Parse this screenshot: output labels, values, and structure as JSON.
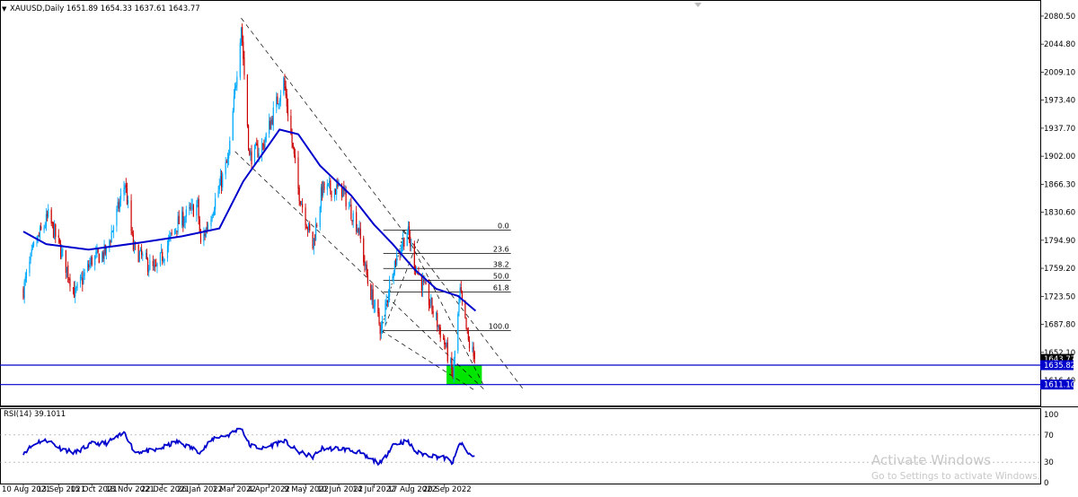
{
  "header": {
    "arrow_glyph": "▼",
    "symbol_info": "XAUUSD,Daily  1651.89 1654.33 1637.61 1643.77"
  },
  "rsi_header": "RSI(14) 39.1011",
  "price_axis": [
    "2080.50",
    "2044.80",
    "2009.10",
    "1973.40",
    "1937.70",
    "1902.00",
    "1866.30",
    "1830.60",
    "1794.90",
    "1759.20",
    "1723.50",
    "1687.80",
    "1652.10",
    "1616.40"
  ],
  "price_badges": {
    "current": "1643.77",
    "support_top": "1635.82",
    "support_bottom": "1611.10"
  },
  "rsi_axis": [
    "100",
    "70",
    "30",
    "0"
  ],
  "date_axis": [
    "10 Aug 2021",
    "13 Sep 2021",
    "15 Oct 2021",
    "18 Nov 2021",
    "22 Dec 2021",
    "26 Jan 2022",
    "1 Mar 2022",
    "4 Apr 2022",
    "9 May 2022",
    "10 Jun 2022",
    "14 Jul 2022",
    "17 Aug 2022",
    "20 Sep 2022"
  ],
  "fib_levels": [
    "0.0",
    "23.6",
    "38.2",
    "50.0",
    "61.8",
    "100.0"
  ],
  "watermark": {
    "title": "Activate Windows",
    "subtitle": "Go to Settings to activate Windows."
  },
  "colors": {
    "bull": "#00aaff",
    "bear": "#cc0000",
    "ma": "#0000cc",
    "rsi": "#0000cc",
    "support_zone": "#00e600",
    "badge_bg": "#0000cc",
    "price_badge_bg": "#000000"
  },
  "chart_data": [
    {
      "type": "candlestick",
      "symbol": "XAUUSD",
      "timeframe": "Daily",
      "last_bar": {
        "open": 1651.89,
        "high": 1654.33,
        "low": 1637.61,
        "close": 1643.77
      },
      "ylim": [
        1605,
        2085
      ],
      "x_ticks": [
        "10 Aug 2021",
        "13 Sep 2021",
        "15 Oct 2021",
        "18 Nov 2021",
        "22 Dec 2021",
        "26 Jan 2022",
        "1 Mar 2022",
        "4 Apr 2022",
        "9 May 2022",
        "10 Jun 2022",
        "14 Jul 2022",
        "17 Aug 2022",
        "20 Sep 2022"
      ],
      "path_points": [
        {
          "date": "2021-08-10",
          "price": 1732
        },
        {
          "date": "2021-08-20",
          "price": 1785
        },
        {
          "date": "2021-09-03",
          "price": 1825
        },
        {
          "date": "2021-09-13",
          "price": 1790
        },
        {
          "date": "2021-09-29",
          "price": 1726
        },
        {
          "date": "2021-10-15",
          "price": 1770
        },
        {
          "date": "2021-10-29",
          "price": 1780
        },
        {
          "date": "2021-11-16",
          "price": 1868
        },
        {
          "date": "2021-11-24",
          "price": 1785
        },
        {
          "date": "2021-12-15",
          "price": 1755
        },
        {
          "date": "2022-01-05",
          "price": 1815
        },
        {
          "date": "2022-01-25",
          "price": 1840
        },
        {
          "date": "2022-01-28",
          "price": 1788
        },
        {
          "date": "2022-02-24",
          "price": 1900
        },
        {
          "date": "2022-03-08",
          "price": 2070
        },
        {
          "date": "2022-03-16",
          "price": 1900
        },
        {
          "date": "2022-03-29",
          "price": 1915
        },
        {
          "date": "2022-04-18",
          "price": 1998
        },
        {
          "date": "2022-05-02",
          "price": 1860
        },
        {
          "date": "2022-05-16",
          "price": 1787
        },
        {
          "date": "2022-05-25",
          "price": 1860
        },
        {
          "date": "2022-06-13",
          "price": 1860
        },
        {
          "date": "2022-06-29",
          "price": 1810
        },
        {
          "date": "2022-07-08",
          "price": 1742
        },
        {
          "date": "2022-07-21",
          "price": 1680
        },
        {
          "date": "2022-08-01",
          "price": 1760
        },
        {
          "date": "2022-08-15",
          "price": 1808
        },
        {
          "date": "2022-08-24",
          "price": 1757
        },
        {
          "date": "2022-09-07",
          "price": 1712
        },
        {
          "date": "2022-09-21",
          "price": 1660
        },
        {
          "date": "2022-09-28",
          "price": 1622
        },
        {
          "date": "2022-10-05",
          "price": 1728
        },
        {
          "date": "2022-10-13",
          "price": 1665
        },
        {
          "date": "2022-10-19",
          "price": 1643.77
        }
      ],
      "moving_average": [
        {
          "date": "2021-08-10",
          "price": 1806
        },
        {
          "date": "2021-09-01",
          "price": 1790
        },
        {
          "date": "2021-10-12",
          "price": 1783
        },
        {
          "date": "2021-12-01",
          "price": 1792
        },
        {
          "date": "2022-01-10",
          "price": 1800
        },
        {
          "date": "2022-02-15",
          "price": 1810
        },
        {
          "date": "2022-03-10",
          "price": 1870
        },
        {
          "date": "2022-04-14",
          "price": 1936
        },
        {
          "date": "2022-05-02",
          "price": 1930
        },
        {
          "date": "2022-05-23",
          "price": 1890
        },
        {
          "date": "2022-06-22",
          "price": 1852
        },
        {
          "date": "2022-07-14",
          "price": 1815
        },
        {
          "date": "2022-08-01",
          "price": 1790
        },
        {
          "date": "2022-08-22",
          "price": 1758
        },
        {
          "date": "2022-09-12",
          "price": 1733
        },
        {
          "date": "2022-10-03",
          "price": 1724
        },
        {
          "date": "2022-10-20",
          "price": 1705
        }
      ],
      "fibonacci": {
        "high": {
          "date": "2022-08-12",
          "price": 1808
        },
        "low": {
          "date": "2022-07-21",
          "price": 1680
        },
        "levels": [
          {
            "label": "0.0",
            "price": 1808
          },
          {
            "label": "23.6",
            "price": 1778
          },
          {
            "label": "38.2",
            "price": 1759
          },
          {
            "label": "50.0",
            "price": 1744
          },
          {
            "label": "61.8",
            "price": 1729
          },
          {
            "label": "100.0",
            "price": 1680
          }
        ]
      },
      "support_zone": {
        "top": 1635.82,
        "bottom": 1611.1
      },
      "horizontal_lines": [
        1635.82,
        1611.1
      ]
    },
    {
      "type": "line",
      "name": "RSI(14)",
      "last_value": 39.1011,
      "ylim": [
        0,
        100
      ],
      "levels": [
        70,
        30
      ],
      "points": [
        {
          "date": "2021-08-10",
          "value": 44
        },
        {
          "date": "2021-08-24",
          "value": 60
        },
        {
          "date": "2021-09-03",
          "value": 62
        },
        {
          "date": "2021-09-15",
          "value": 50
        },
        {
          "date": "2021-09-29",
          "value": 44
        },
        {
          "date": "2021-10-15",
          "value": 57
        },
        {
          "date": "2021-10-29",
          "value": 58
        },
        {
          "date": "2021-11-16",
          "value": 73
        },
        {
          "date": "2021-11-25",
          "value": 45
        },
        {
          "date": "2021-12-15",
          "value": 47
        },
        {
          "date": "2022-01-05",
          "value": 60
        },
        {
          "date": "2022-01-28",
          "value": 45
        },
        {
          "date": "2022-02-10",
          "value": 66
        },
        {
          "date": "2022-02-24",
          "value": 70
        },
        {
          "date": "2022-03-08",
          "value": 81
        },
        {
          "date": "2022-03-16",
          "value": 55
        },
        {
          "date": "2022-03-29",
          "value": 50
        },
        {
          "date": "2022-04-18",
          "value": 62
        },
        {
          "date": "2022-05-02",
          "value": 45
        },
        {
          "date": "2022-05-16",
          "value": 38
        },
        {
          "date": "2022-05-25",
          "value": 50
        },
        {
          "date": "2022-06-13",
          "value": 50
        },
        {
          "date": "2022-06-29",
          "value": 45
        },
        {
          "date": "2022-07-08",
          "value": 36
        },
        {
          "date": "2022-07-21",
          "value": 28
        },
        {
          "date": "2022-08-01",
          "value": 56
        },
        {
          "date": "2022-08-15",
          "value": 61
        },
        {
          "date": "2022-08-24",
          "value": 44
        },
        {
          "date": "2022-09-07",
          "value": 40
        },
        {
          "date": "2022-09-21",
          "value": 36
        },
        {
          "date": "2022-09-28",
          "value": 29
        },
        {
          "date": "2022-10-05",
          "value": 59
        },
        {
          "date": "2022-10-13",
          "value": 42
        },
        {
          "date": "2022-10-19",
          "value": 39.1
        }
      ]
    }
  ]
}
